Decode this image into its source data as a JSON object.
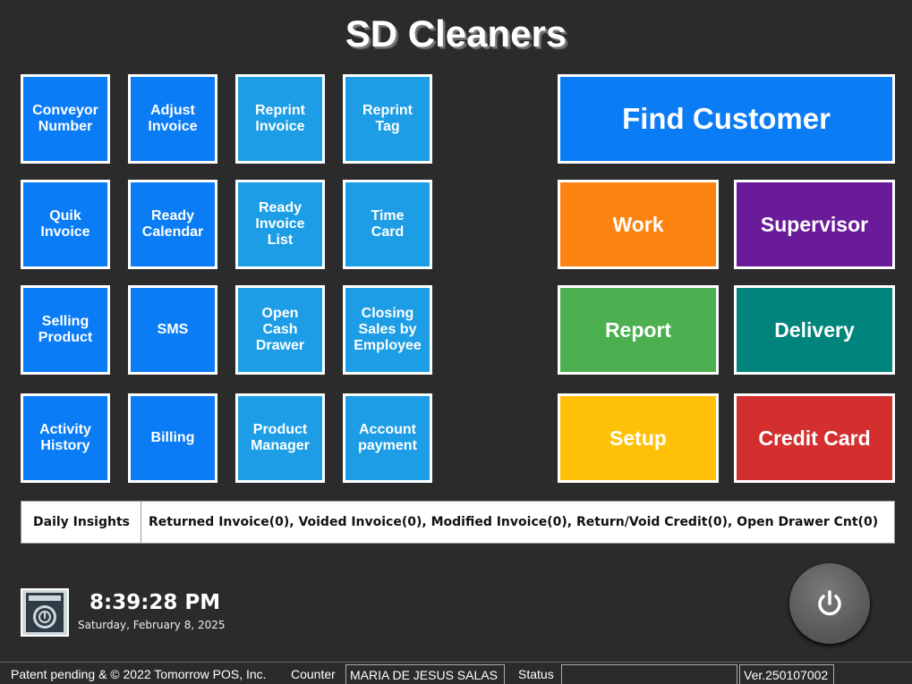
{
  "app": {
    "title": "SD Cleaners"
  },
  "colors": {
    "background": "#2b2b2b",
    "blue": "#0a7cf5",
    "light_blue": "#1d9de5",
    "orange": "#fd8311",
    "purple": "#6a1b9a",
    "green": "#4caf50",
    "teal": "#00847b",
    "yellow": "#ffc107",
    "red": "#d32f2f"
  },
  "tiles": [
    {
      "label": "Conveyor\nNumber"
    },
    {
      "label": "Adjust\nInvoice"
    },
    {
      "label": "Reprint\nInvoice"
    },
    {
      "label": "Reprint\nTag"
    },
    {
      "label": "Quik\nInvoice"
    },
    {
      "label": "Ready\nCalendar"
    },
    {
      "label": "Ready\nInvoice\nList"
    },
    {
      "label": "Time\nCard"
    },
    {
      "label": "Selling\nProduct"
    },
    {
      "label": "SMS"
    },
    {
      "label": "Open\nCash\nDrawer"
    },
    {
      "label": "Closing\nSales by\nEmployee"
    },
    {
      "label": "Activity\nHistory"
    },
    {
      "label": "Billing"
    },
    {
      "label": "Product\nManager"
    },
    {
      "label": "Account\npayment"
    }
  ],
  "actions": {
    "find_customer": "Find Customer",
    "work": "Work",
    "supervisor": "Supervisor",
    "report": "Report",
    "delivery": "Delivery",
    "setup": "Setup",
    "credit_card": "Credit Card"
  },
  "insights": {
    "label": "Daily Insights",
    "message": "Returned Invoice(0), Voided Invoice(0), Modified Invoice(0), Return/Void Credit(0), Open Drawer Cnt(0)"
  },
  "clock": {
    "time": "8:39:28 PM",
    "date": "Saturday, February 8, 2025",
    "icon": "washing-machine-icon"
  },
  "power": {
    "icon": "power-icon"
  },
  "statusbar": {
    "copyright": "Patent pending & © 2022 Tomorrow POS, Inc.",
    "counter_label": "Counter",
    "counter_value": "MARIA DE JESUS SALAS",
    "status_label": "Status",
    "status_value": "",
    "version": "Ver.250107002"
  }
}
